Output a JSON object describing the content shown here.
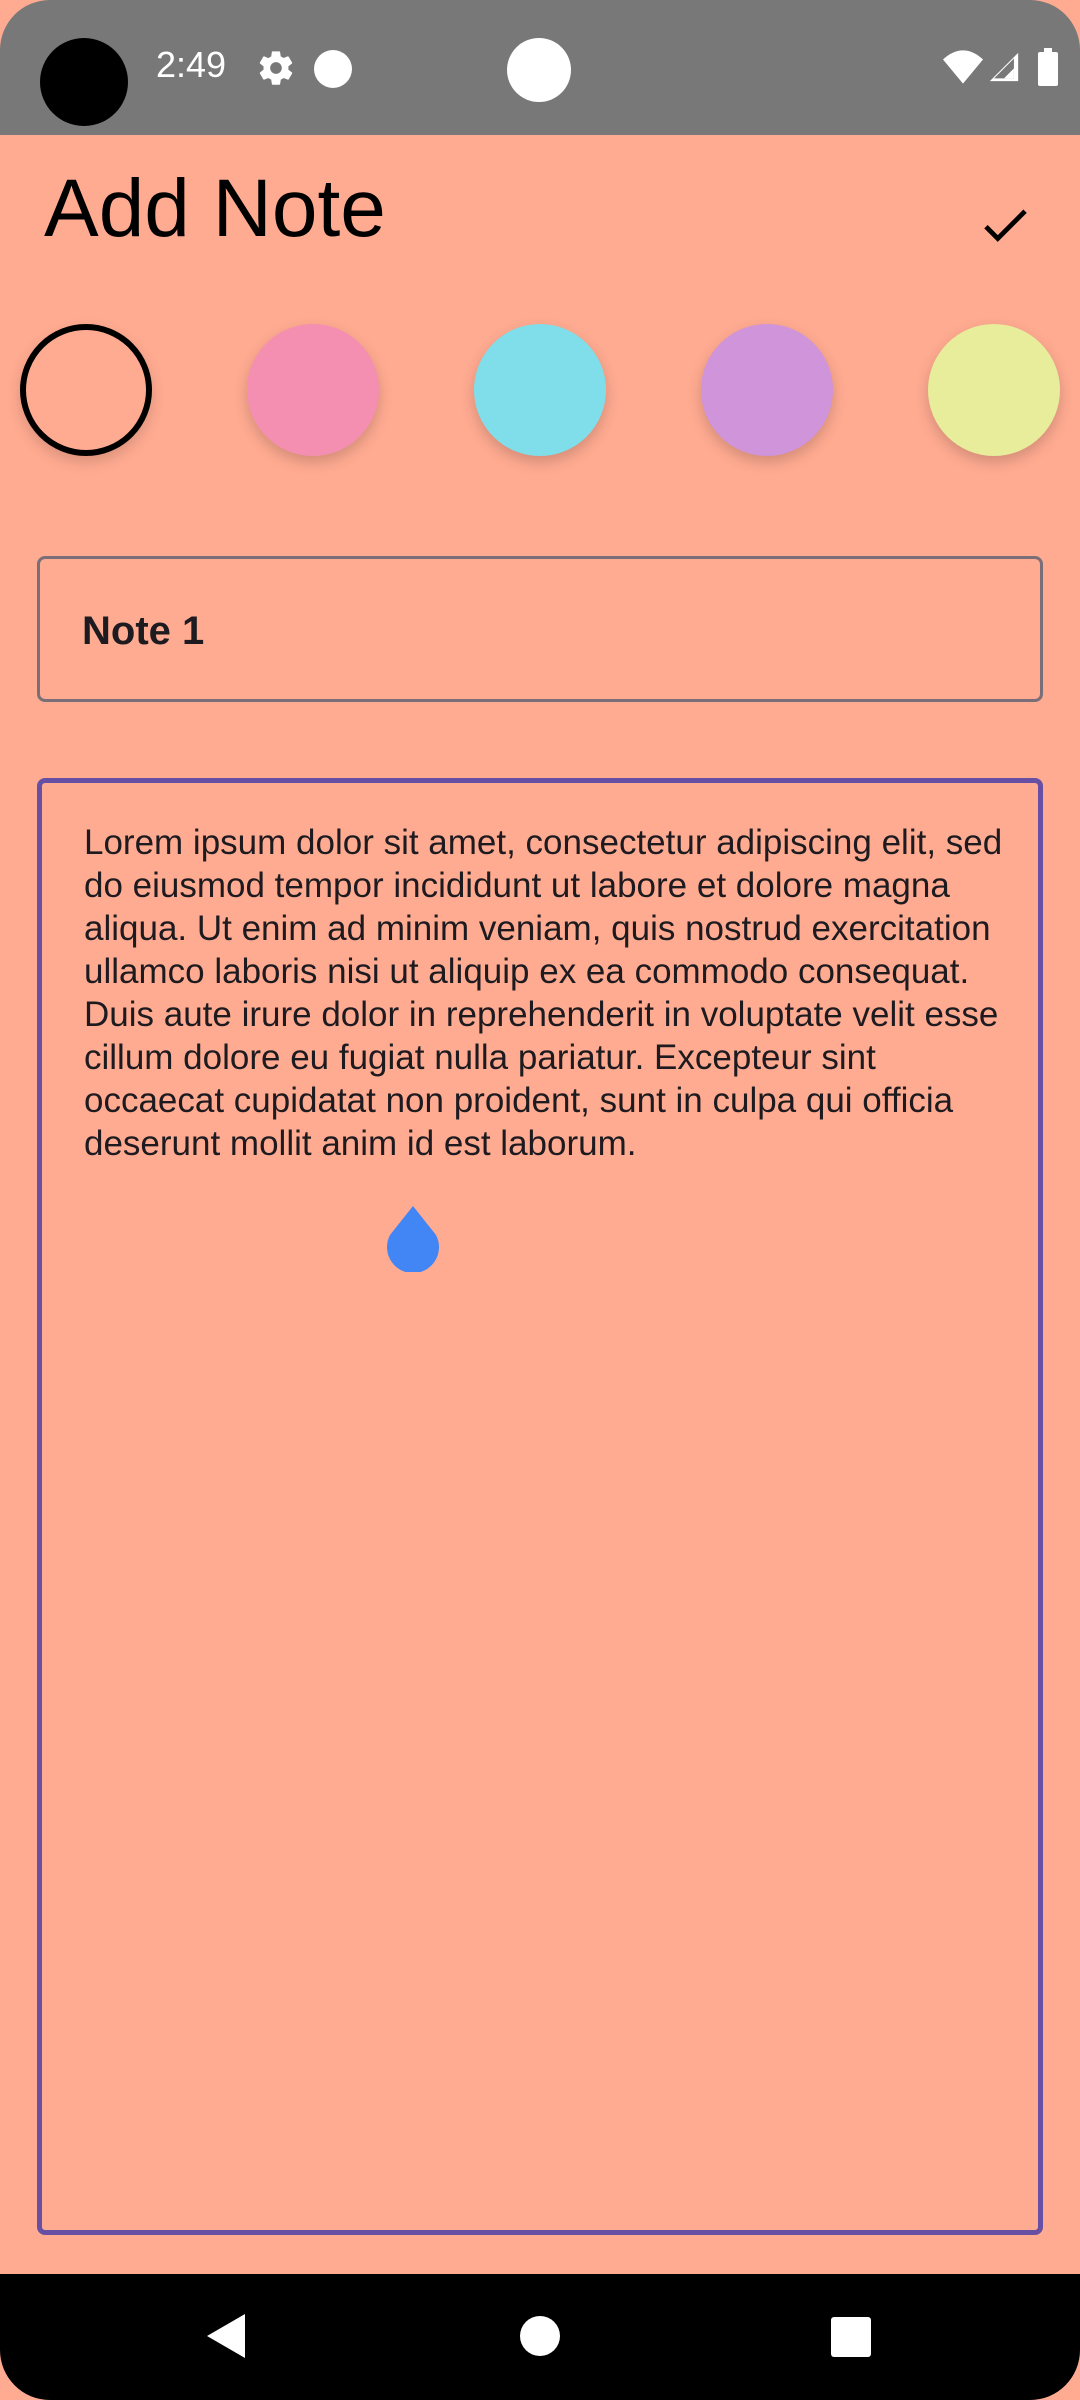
{
  "status_bar": {
    "time": "2:49",
    "icons": [
      "gear-icon",
      "dot-icon",
      "wifi-icon",
      "signal-icon",
      "battery-icon"
    ]
  },
  "header": {
    "title": "Add Note",
    "confirm_icon": "check-icon"
  },
  "color_picker": {
    "selected_index": 0,
    "swatches": [
      {
        "name": "peach",
        "color": "#ffab91"
      },
      {
        "name": "pink",
        "color": "#f48fb1"
      },
      {
        "name": "cyan",
        "color": "#80deea"
      },
      {
        "name": "lavender",
        "color": "#cf94da"
      },
      {
        "name": "yellow",
        "color": "#e7ed9b"
      }
    ]
  },
  "note": {
    "title": "Note 1",
    "body": "Lorem ipsum dolor sit amet, consectetur adipiscing elit, sed do eiusmod tempor incididunt ut labore et dolore magna aliqua. Ut enim ad minim veniam, quis nostrud exercitation ullamco laboris nisi ut aliquip ex ea commodo consequat. Duis aute irure dolor in reprehenderit in voluptate velit esse cillum dolore eu fugiat nulla pariatur. Excepteur sint occaecat cupidatat non proident, sunt in culpa qui officia deserunt mollit anim id est laborum."
  },
  "colors": {
    "background": "#ffab91",
    "focused_outline": "#6750a4",
    "outline": "#7a6f79",
    "cursor_handle": "#4285f4"
  },
  "nav_bar": {
    "icons": [
      "back-icon",
      "home-icon",
      "recents-icon"
    ]
  }
}
